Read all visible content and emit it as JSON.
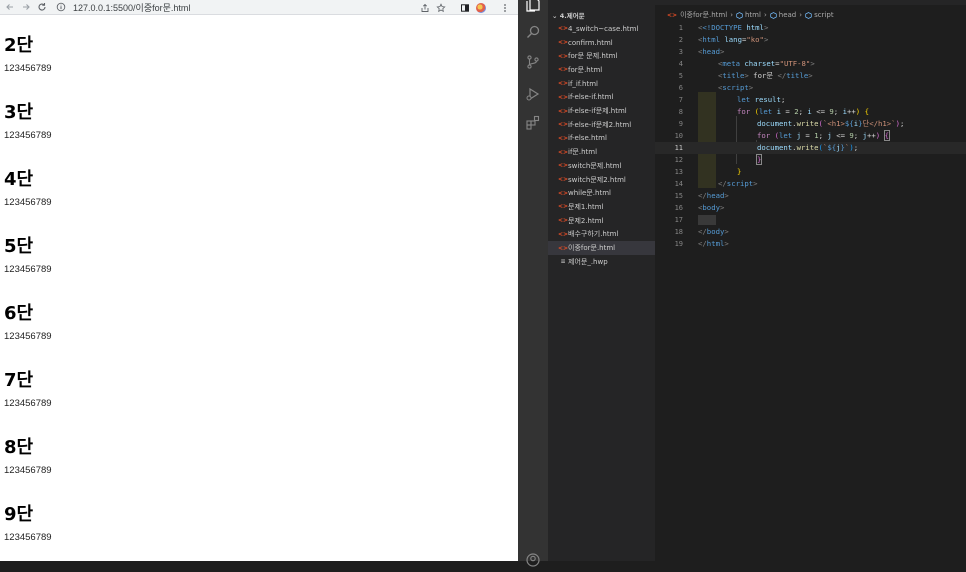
{
  "browser": {
    "url": "127.0.0.1:5500/이중for문.html",
    "blocks": [
      {
        "heading": "2단",
        "numbers": "123456789"
      },
      {
        "heading": "3단",
        "numbers": "123456789"
      },
      {
        "heading": "4단",
        "numbers": "123456789"
      },
      {
        "heading": "5단",
        "numbers": "123456789"
      },
      {
        "heading": "6단",
        "numbers": "123456789"
      },
      {
        "heading": "7단",
        "numbers": "123456789"
      },
      {
        "heading": "8단",
        "numbers": "123456789"
      },
      {
        "heading": "9단",
        "numbers": "123456789"
      }
    ]
  },
  "explorer": {
    "folder": "4.제어문",
    "files": [
      "4_switch~case.html",
      "confirm.html",
      "for문 문제.html",
      "for문.html",
      "if_if.html",
      "if-else-if.html",
      "if-else-if문제.html",
      "if-else-if문제2.html",
      "if-else.html",
      "if문.html",
      "switch문제.html",
      "switch문제2.html",
      "while문.html",
      "문제1.html",
      "문제2.html",
      "배수구하기.html",
      "이중for문.html",
      "제어문_.hwp"
    ],
    "active_file": "이중for문.html"
  },
  "editor": {
    "breadcrumb": [
      "이중for문.html",
      "html",
      "head",
      "script"
    ],
    "line_numbers": [
      "1",
      "2",
      "3",
      "4",
      "5",
      "6",
      "7",
      "8",
      "9",
      "10",
      "11",
      "12",
      "13",
      "14",
      "15",
      "16",
      "17",
      "18",
      "19"
    ],
    "current_line": "11",
    "code": {
      "l1_doctype": "<!DOCTYPE",
      "l1_html": "html",
      "l2_tag": "html",
      "l2_attr": "lang",
      "l2_val": "\"ko\"",
      "l3_tag": "head",
      "l4_tag": "meta",
      "l4_attr": "charset",
      "l4_val": "\"UTF-8\"",
      "l5_tag": "title",
      "l5_text": " for문 ",
      "l6_tag": "script",
      "l7_kw": "let",
      "l7_var": "result",
      "l8_for": "for",
      "l8_let": "let",
      "l8_i1": "i",
      "l8_2": "2",
      "l8_i2": "i",
      "l8_9": "9",
      "l8_i3": "i",
      "l9_doc": "document",
      "l9_write": "write",
      "l9_str1": "`<h1>",
      "l9_tpl": "${",
      "l9_i": "i",
      "l9_str2": "단</h1>`",
      "l10_for": "for",
      "l10_let": "let",
      "l10_j1": "j",
      "l10_1": "1",
      "l10_j2": "j",
      "l10_9": "9",
      "l10_j3": "j",
      "l11_doc": "document",
      "l11_write": "write",
      "l11_str1": "`",
      "l11_tpl": "${",
      "l11_j": "j",
      "l11_str2": "`",
      "l14_tag": "script",
      "l15_tag": "head",
      "l16_tag": "body",
      "l18_tag": "body",
      "l19_tag": "html"
    }
  },
  "colors": {
    "editor_bg": "#1e1e1e",
    "sidebar_bg": "#252526",
    "activity_bg": "#333333",
    "html_icon": "#e44d26"
  }
}
